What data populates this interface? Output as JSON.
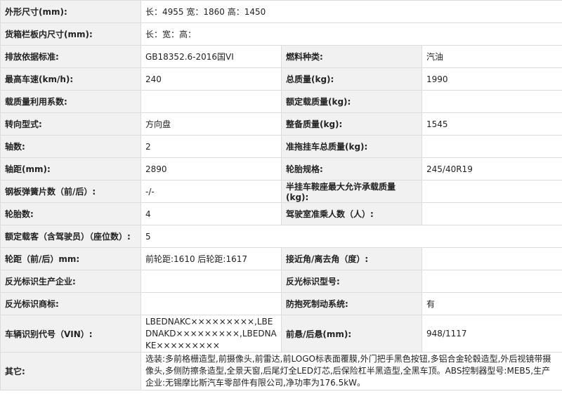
{
  "spec": {
    "dims": {
      "label": "外形尺寸(mm):",
      "value": "长：4955 宽：1860 高：1450"
    },
    "cargo": {
      "label": "货箱栏板内尺寸(mm):",
      "value": "长：宽：高："
    },
    "rows": [
      {
        "l1": "排放依据标准:",
        "v1": "GB18352.6-2016国VI",
        "l2": "燃料种类:",
        "v2": "汽油"
      },
      {
        "l1": "最高车速(km/h):",
        "v1": "240",
        "l2": "总质量(kg):",
        "v2": "1990"
      },
      {
        "l1": "载质量利用系数:",
        "v1": "",
        "l2": "额定载质量(kg):",
        "v2": ""
      },
      {
        "l1": "转向型式:",
        "v1": "方向盘",
        "l2": "整备质量(kg):",
        "v2": "1545"
      },
      {
        "l1": "轴数:",
        "v1": "2",
        "l2": "准拖挂车总质量(kg):",
        "v2": ""
      },
      {
        "l1": "轴距(mm):",
        "v1": "2890",
        "l2": "轮胎规格:",
        "v2": "245/40R19"
      },
      {
        "l1": "钢板弹簧片数（前/后）:",
        "v1": "-/-",
        "l2": "半挂车鞍座最大允许承载质量(kg):",
        "v2": ""
      },
      {
        "l1": "轮胎数:",
        "v1": "4",
        "l2": "驾驶室准乘人数（人）:",
        "v2": ""
      }
    ],
    "seats": {
      "label": "额定载客（含驾驶员）（座位数）:",
      "value": "5"
    },
    "rows2": [
      {
        "l1": "轮距（前/后）mm:",
        "v1": "前轮距:1610 后轮距:1617",
        "l2": "接近角/离去角（度）:",
        "v2": ""
      },
      {
        "l1": "反光标识生产企业:",
        "v1": "",
        "l2": "反光标识型号:",
        "v2": ""
      },
      {
        "l1": "反光标识商标:",
        "v1": "",
        "l2": "防抱死制动系统:",
        "v2": "有"
      }
    ],
    "vin": {
      "l1": "车辆识别代号（VIN）:",
      "v1": "LBEDNAKC×××××××××,LBEDNAKD×××××××××,LBEDNAKE×××××××××",
      "l2": "前悬/后悬(mm):",
      "v2": "948/1117"
    },
    "other": {
      "label": "其它:",
      "value": "选装:多前格栅造型,前摄像头,前雷达,前LOGO标表面覆膜,外门把手黑色按钮,多铝合金轮毂造型,外后视镜带摄像头,多侧防擦条造型,全景天窗,后尾灯全LED灯芯,后保险杠半黑造型,全黑车顶。ABS控制器型号:MEB5,生产企业:无锡摩比斯汽车零部件有限公司,净功率为176.5kW。"
    }
  }
}
